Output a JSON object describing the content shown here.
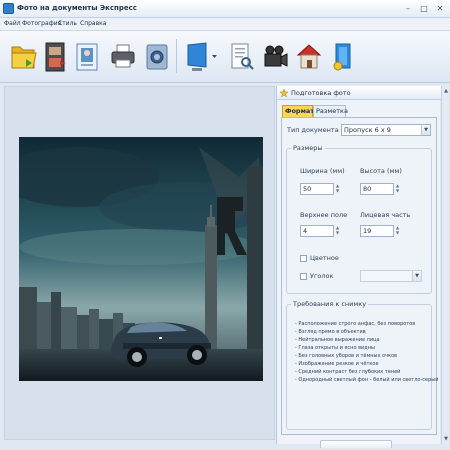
{
  "window": {
    "title": "Фото на документы Экспресс",
    "minimize_label": "–",
    "maximize_label": "□",
    "close_label": "✕"
  },
  "menu": {
    "items": [
      {
        "label": "Файл"
      },
      {
        "label": "Фотография"
      },
      {
        "label": "Стиль"
      },
      {
        "label": "Справка"
      }
    ]
  },
  "toolbar": {
    "buttons": [
      {
        "icon": "open-folder-icon"
      },
      {
        "icon": "filmstrip-icon"
      },
      {
        "icon": "photo-card-icon"
      },
      {
        "icon": "printer-icon"
      },
      {
        "icon": "camera-icon"
      },
      {
        "icon": "monitor-icon"
      },
      {
        "icon": "document-search-icon"
      },
      {
        "icon": "video-camera-icon"
      },
      {
        "icon": "home-icon"
      },
      {
        "icon": "install-box-icon"
      }
    ]
  },
  "panel": {
    "header": "Подготовка фото",
    "tabs": [
      {
        "label": "Формат",
        "active": true
      },
      {
        "label": "Разметка",
        "active": false
      }
    ],
    "document_type_label": "Тип документа",
    "document_type_value": "Пропуск 6 x 9",
    "sizes_group": "Размеры",
    "width_label": "Ширина (мм)",
    "width_value": "50",
    "height_label": "Высота (мм)",
    "height_value": "80",
    "top_margin_label": "Верхнее поле",
    "top_margin_value": "4",
    "face_part_label": "Лицевая часть",
    "face_part_value": "19",
    "color_label": "Цветное",
    "corner_label": "Уголок",
    "requirements_group": "Требования к снимку",
    "requirements": [
      "- Расположение строго анфас, без поворотов",
      "- Взгляд прямо в объектив",
      "- Нейтральное выражение лица",
      "- Глаза открыты и ясно видны",
      "- Без головных уборов и тёмных очков",
      "- Изображение резкое и чёткое",
      "- Средний контраст без глубоких теней",
      "- Однородный светлый фон - белый или светло-серый"
    ]
  },
  "scroll": {
    "up": "▲",
    "down": "▼"
  },
  "colors": {
    "accent_tab": "#ffd65a",
    "window_bg": "#dfe8f3",
    "panel_bg": "#eef3fa"
  }
}
